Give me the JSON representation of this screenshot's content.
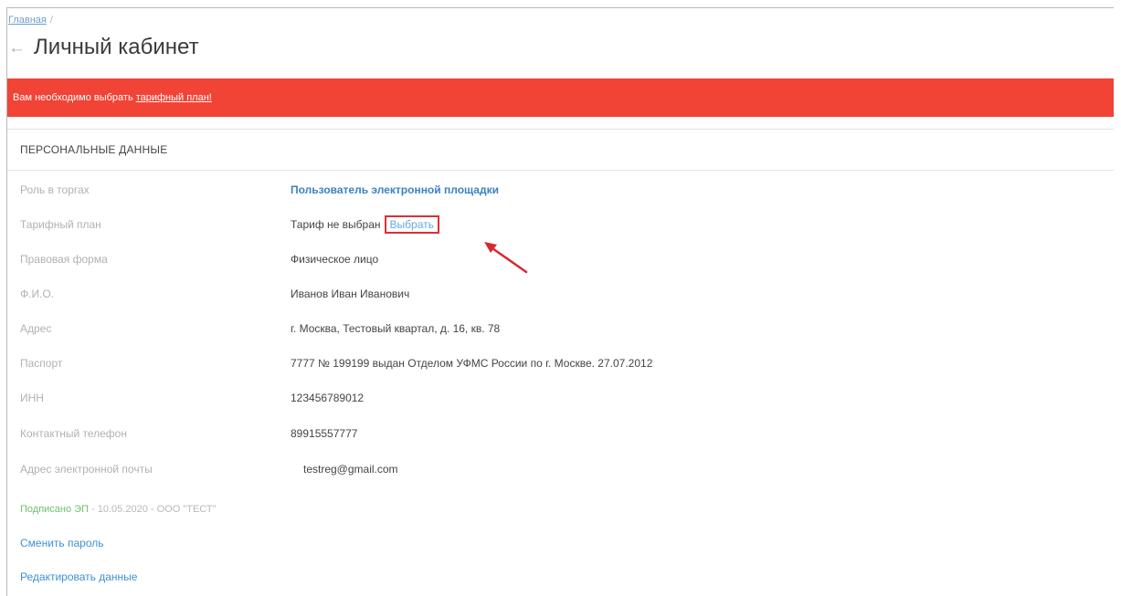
{
  "breadcrumb": {
    "home": "Главная",
    "separator": "/"
  },
  "page": {
    "back_icon": "arrow-left-icon",
    "title": "Личный кабинет"
  },
  "alert": {
    "text": "Вам необходимо выбрать",
    "link": "тарифный план!",
    "color": "#f14336"
  },
  "section": {
    "title": "ПЕРСОНАЛЬНЫЕ ДАННЫЕ"
  },
  "fields": [
    {
      "label": "Роль в торгах",
      "value": "Пользователь электронной площадки"
    },
    {
      "label": "Тарифный план",
      "value": "Тариф не выбран",
      "action": "Выбрать"
    },
    {
      "label": "Правовая форма",
      "value": "Физическое лицо"
    },
    {
      "label": "Ф.И.О.",
      "value": "Иванов Иван Иванович"
    },
    {
      "label": "Адрес",
      "value": "г. Москва, Тестовый квартал, д. 16, кв. 78"
    },
    {
      "label": "Паспорт",
      "value": "7777 № 199199 выдан Отделом УФМС России по г. Москве. 27.07.2012"
    },
    {
      "label": "ИНН",
      "value": "123456789012"
    },
    {
      "label": "Контактный телефон",
      "value": "89915557777"
    },
    {
      "label": "Адрес электронной почты",
      "value": "testreg@gmail.com"
    }
  ],
  "signature": {
    "signed": "Подписано ЭП",
    "sep1": " - ",
    "date": "10.05.2020",
    "sep2": " - ",
    "org": "ООО \"ТЕСТ\""
  },
  "actions": {
    "change_password": "Сменить пароль",
    "edit_data": "Редактировать данные"
  },
  "colors": {
    "link": "#3c91d2",
    "highlight_box": "#d83236",
    "arrow": "#d8282f"
  }
}
